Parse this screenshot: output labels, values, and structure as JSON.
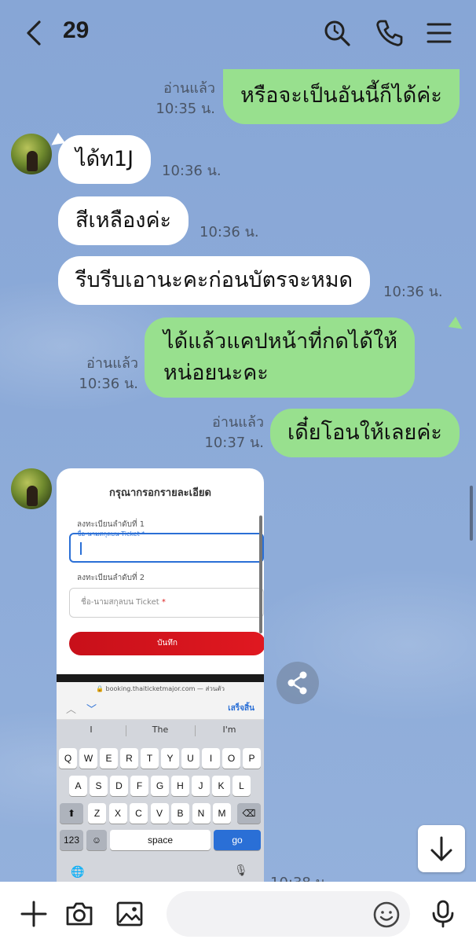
{
  "header": {
    "title": "29",
    "icons": [
      "back-icon",
      "search-icon",
      "phone-icon",
      "menu-icon"
    ]
  },
  "messages": [
    {
      "side": "out",
      "text_lines": [
        "หรือจะเป็นอันนี้ก็ได้ค่ะ"
      ],
      "read": "อ่านแล้ว",
      "time": "10:35 น."
    },
    {
      "side": "in",
      "text_lines": [
        "ได้ท1J"
      ],
      "time": "10:36 น."
    },
    {
      "side": "in",
      "text_lines": [
        "สีเหลืองค่ะ"
      ],
      "time": "10:36 น."
    },
    {
      "side": "in",
      "text_lines": [
        "รีบรีบเอานะคะก่อนบัตรจะหมด"
      ],
      "time": "10:36 น."
    },
    {
      "side": "out",
      "text_lines": [
        "ได้แล้วแคปหน้าที่กดได้ให้",
        "หน่อยนะคะ"
      ],
      "read": "อ่านแล้ว",
      "time": "10:36 น."
    },
    {
      "side": "out",
      "text_lines": [
        "เดี๋ยโอนให้เลยค่ะ"
      ],
      "read": "อ่านแล้ว",
      "time": "10:37 น."
    }
  ],
  "image_message": {
    "time_partial": "10:38 น",
    "screenshot": {
      "form_title": "กรุณากรอกรายละเอียด",
      "field1_label": "ลงทะเบียนลำดับที่ 1",
      "field1_floating": "ชื่อ-นามสกุลบน Ticket *",
      "field2_label": "ลงทะเบียนลำดับที่ 2",
      "field2_placeholder": "ชื่อ-นามสกุลบน Ticket",
      "required_mark": "*",
      "save_label": "บันทึก",
      "url": "booking.thaiticketmajor.com — ส่วนตัว",
      "done_label": "เสร็จสิ้น",
      "suggestions": [
        "I",
        "The",
        "I'm"
      ],
      "keys_row1": [
        "Q",
        "W",
        "E",
        "R",
        "T",
        "Y",
        "U",
        "I",
        "O",
        "P"
      ],
      "keys_row2": [
        "A",
        "S",
        "D",
        "F",
        "G",
        "H",
        "J",
        "K",
        "L"
      ],
      "keys_row3": [
        "Z",
        "X",
        "C",
        "V",
        "B",
        "N",
        "M"
      ],
      "key_123": "123",
      "key_space": "space",
      "key_go": "go"
    }
  },
  "composer": {
    "placeholder": ""
  },
  "colors": {
    "outgoing_bubble": "#98e08e",
    "incoming_bubble": "#ffffff",
    "chat_background": "#8aaad8"
  }
}
